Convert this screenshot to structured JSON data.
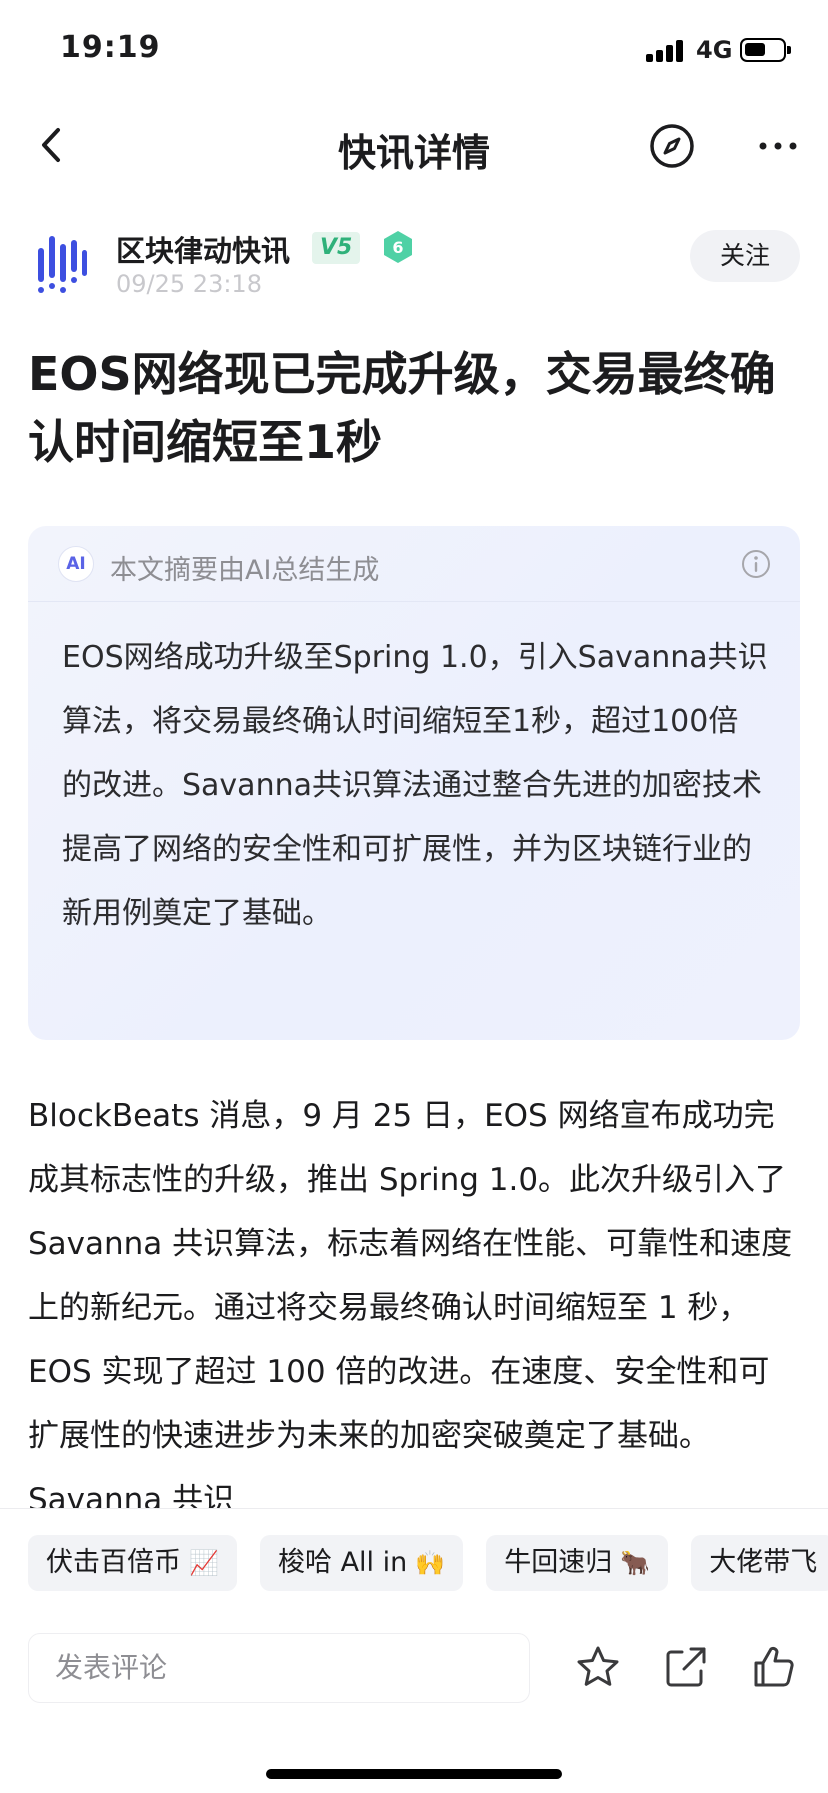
{
  "status_bar": {
    "time": "19:19",
    "network": "4G"
  },
  "nav": {
    "title": "快讯详情",
    "back_icon": "chevron-left-icon",
    "compass_icon": "compass-icon",
    "more_icon": "more-dots-icon"
  },
  "author": {
    "name": "区块律动快讯",
    "vip_badge": "V5",
    "level": "6",
    "time": "09/25 23:18",
    "follow_label": "关注"
  },
  "article": {
    "headline": "EOS网络现已完成升级，交易最终确认时间缩短至1秒",
    "ai_summary": {
      "icon_text": "AI",
      "label": "本文摘要由AI总结生成",
      "text": "EOS网络成功升级至Spring 1.0，引入Savanna共识算法，将交易最终确认时间缩短至1秒，超过100倍的改进。Savanna共识算法通过整合先进的加密技术提高了网络的安全性和可扩展性，并为区块链行业的新用例奠定了基础。"
    },
    "body": "BlockBeats 消息，9 月 25 日，EOS 网络宣布成功完成其标志性的升级，推出 Spring 1.0。此次升级引入了 Savanna 共识算法，标志着网络在性能、可靠性和速度上的新纪元。通过将交易最终确认时间缩短至 1 秒，EOS 实现了超过 100 倍的改进。在速度、安全性和可扩展性的快速进步为未来的加密突破奠定了基础。Savanna 共识"
  },
  "tags": [
    {
      "label": "伏击百倍币",
      "emoji": "📈"
    },
    {
      "label": "梭哈 All in",
      "emoji": "🙌"
    },
    {
      "label": "牛回速归",
      "emoji": "🐂"
    },
    {
      "label": "大佬带飞",
      "emoji": ""
    }
  ],
  "comment": {
    "placeholder": "发表评论"
  },
  "actions": {
    "favorite_icon": "star-icon",
    "share_icon": "share-icon",
    "like_icon": "thumbs-up-icon"
  },
  "colors": {
    "accent_green": "#2fb17a",
    "ai_purple": "#5a63e6",
    "avatar_blue": "#3d4fe0",
    "summary_bg": "#eef1fd"
  }
}
